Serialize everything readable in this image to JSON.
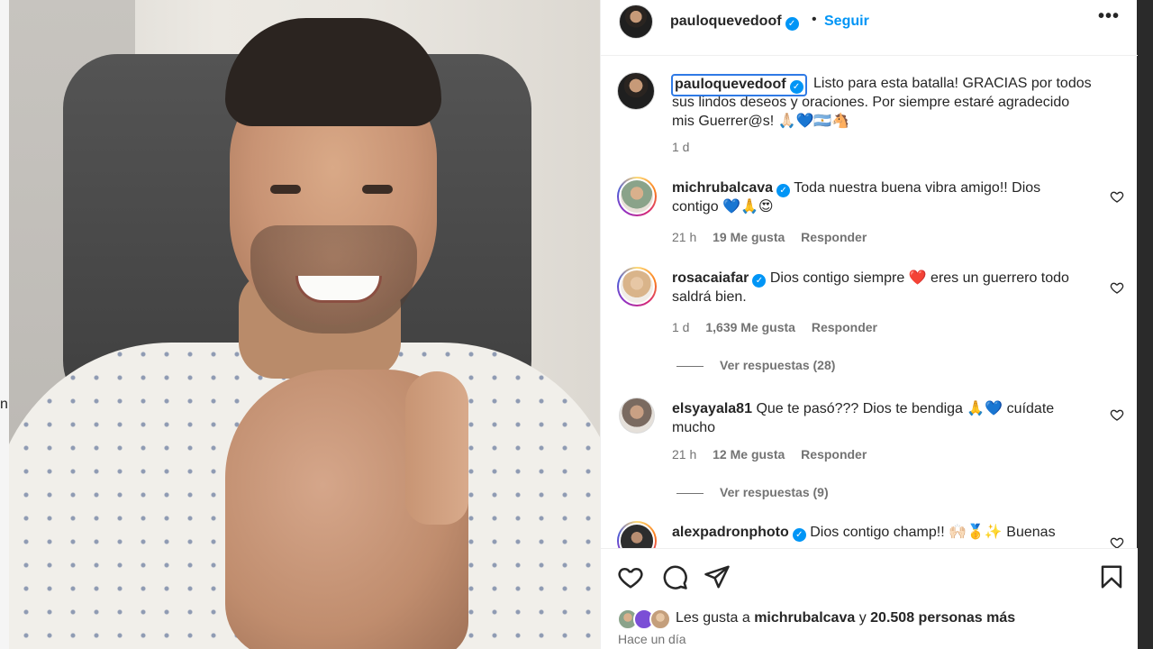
{
  "background": {
    "stray_letter": "n"
  },
  "post": {
    "author": "pauloquevedoof",
    "follow_label": "Seguir",
    "separator": "•",
    "more_label": "•••",
    "verified_glyph": "✓"
  },
  "caption": {
    "username": "pauloquevedoof",
    "text": "Listo para esta batalla! GRACIAS por todos sus lindos deseos y oraciones. Por siempre estaré agradecido mis Guerrer@s! 🙏🏻💙🇦🇷🐴",
    "time": "1 d"
  },
  "comments": [
    {
      "username": "michrubalcava",
      "verified": true,
      "text": "Toda nuestra buena vibra amigo!! Dios contigo 💙🙏😍",
      "time": "21 h",
      "likes": "19 Me gusta",
      "reply_label": "Responder"
    },
    {
      "username": "rosacaiafar",
      "verified": true,
      "text": "Dios contigo siempre ❤️ eres un guerrero todo saldrá bien.",
      "time": "1 d",
      "likes": "1,639 Me gusta",
      "reply_label": "Responder",
      "view_replies": "Ver respuestas (28)"
    },
    {
      "username": "elsyayala81",
      "verified": false,
      "text": "Que te pasó??? Dios te bendiga 🙏💙 cuídate mucho",
      "time": "21 h",
      "likes": "12 Me gusta",
      "reply_label": "Responder",
      "view_replies": "Ver respuestas (9)"
    },
    {
      "username": "alexpadronphoto",
      "verified": true,
      "text": "Dios contigo champ!! 🙌🏻🥇✨ Buenas"
    }
  ],
  "actions": {
    "icons": [
      "heart-icon",
      "comment-icon",
      "share-icon",
      "bookmark-icon"
    ]
  },
  "likes_summary": {
    "prefix": "Les gusta a",
    "user": "michrubalcava",
    "middle": "y",
    "others": "20.508 personas más"
  },
  "posted_time": "Hace un día",
  "colors": {
    "accent_blue": "#0095f6",
    "text": "#262626",
    "muted": "#737373",
    "selection_outline": "#2f7ae5"
  }
}
